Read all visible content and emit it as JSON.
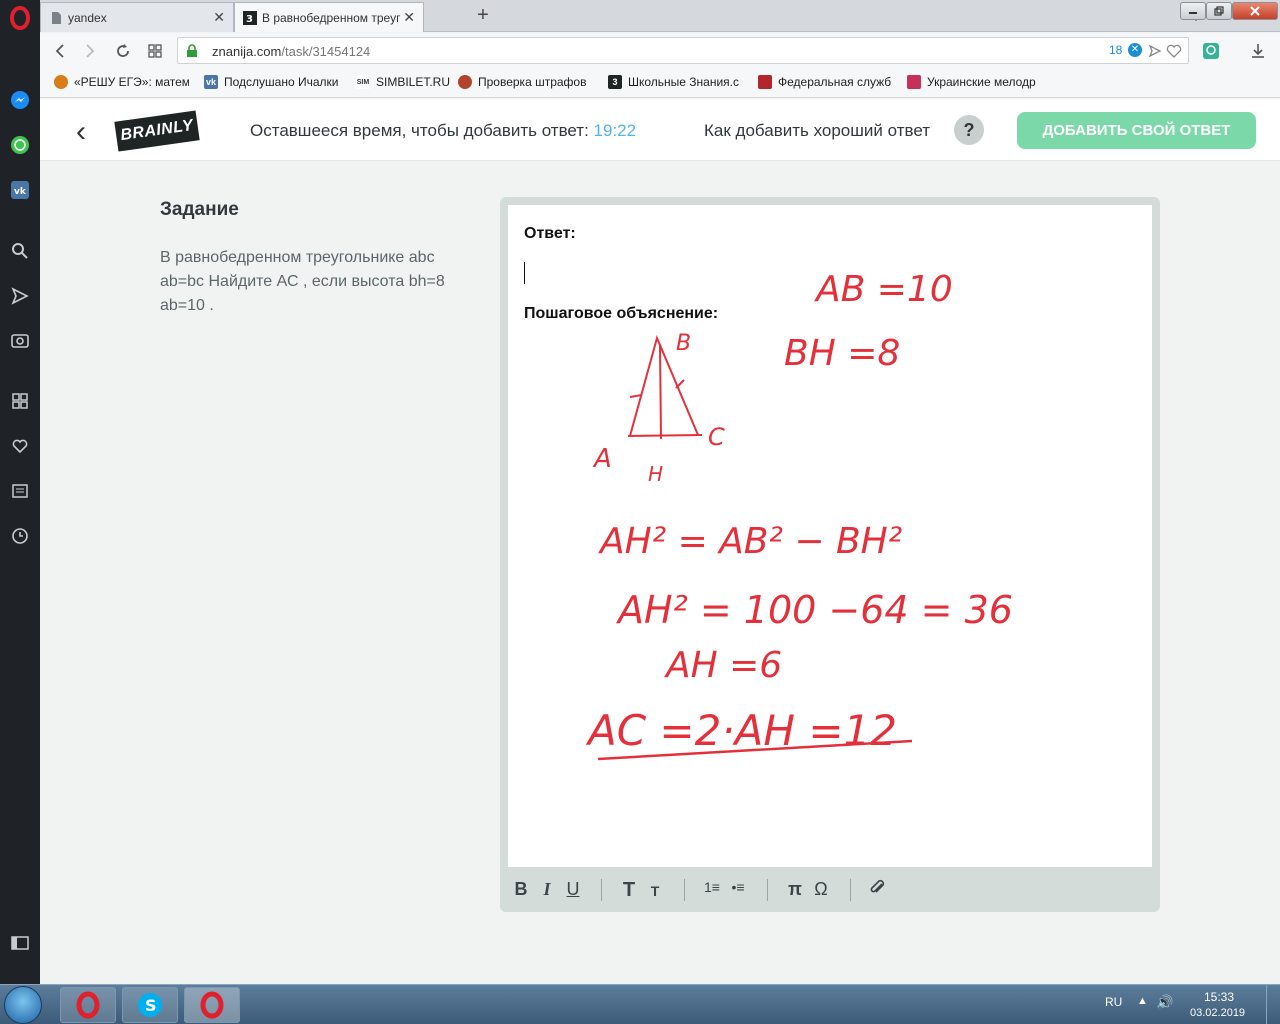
{
  "browser": {
    "tabs": [
      {
        "title": "yandex",
        "close": "✕"
      },
      {
        "title": "В равнобедренном треуг",
        "close": "✕"
      }
    ],
    "new_tab": "+",
    "url": {
      "domain": "znanija.com",
      "path": "/task/31454124"
    },
    "tracker_count": "18",
    "tracker_badge": "✕",
    "bookmarks": [
      {
        "label": "«РЕШУ ЕГЭ»: матема",
        "icon": "sun-icon",
        "color": "#d97c1a"
      },
      {
        "label": "Подслушано Ичалки",
        "icon": "vk-icon",
        "color": "#4a76a8"
      },
      {
        "label": "SIMBILET.RU",
        "icon": "sim-icon",
        "color": "#333333"
      },
      {
        "label": "Проверка штрафов",
        "icon": "emblem-icon",
        "color": "#b0442a"
      },
      {
        "label": "Школьные Знания.с",
        "icon": "znanija-icon",
        "color": "#1e2524"
      },
      {
        "label": "Федеральная служб",
        "icon": "fed-icon",
        "color": "#b3262b"
      },
      {
        "label": "Украинские мелодр",
        "icon": "ua-icon",
        "color": "#c6305a"
      }
    ]
  },
  "header": {
    "back": "‹",
    "logo": "BRAINLY",
    "timer_label": "Оставшееся время, чтобы добавить ответ: ",
    "timer_value": "19:22",
    "how_to": "Как добавить хороший ответ",
    "help": "?",
    "add_answer": "ДОБАВИТЬ СВОЙ ОТВЕТ"
  },
  "task": {
    "heading": "Задание",
    "text": "В равнобедренном треугольнике abc ab=bc Найдите АС , если высота bh=8 ab=10 ."
  },
  "editor": {
    "answer_label": "Ответ:",
    "step_label": "Пошаговое объяснение:",
    "handwriting": {
      "given_ab": "AB =10",
      "given_bh": "BH =8",
      "vertex_a": "A",
      "vertex_b": "B",
      "vertex_c": "C",
      "vertex_h": "H",
      "eq1": "AH² = AB² − BH²",
      "eq2": "AH² = 100 −64 = 36",
      "eq3": "AH =6",
      "eq4": "AC =2·AH =12"
    },
    "toolbar": {
      "bold": "B",
      "italic": "I",
      "underline": "U",
      "big_text": "T",
      "small_text": "T",
      "ordered_list": "1≡",
      "bullet_list": "•≡",
      "pi": "π",
      "omega": "Ω",
      "attach": "📎"
    }
  },
  "taskbar": {
    "lang": "RU",
    "time": "15:33",
    "date": "03.02.2019"
  },
  "colors": {
    "accent_green": "#7bd8a8",
    "timer_blue": "#4fb3f6",
    "handwriting_red": "#e4303a"
  }
}
